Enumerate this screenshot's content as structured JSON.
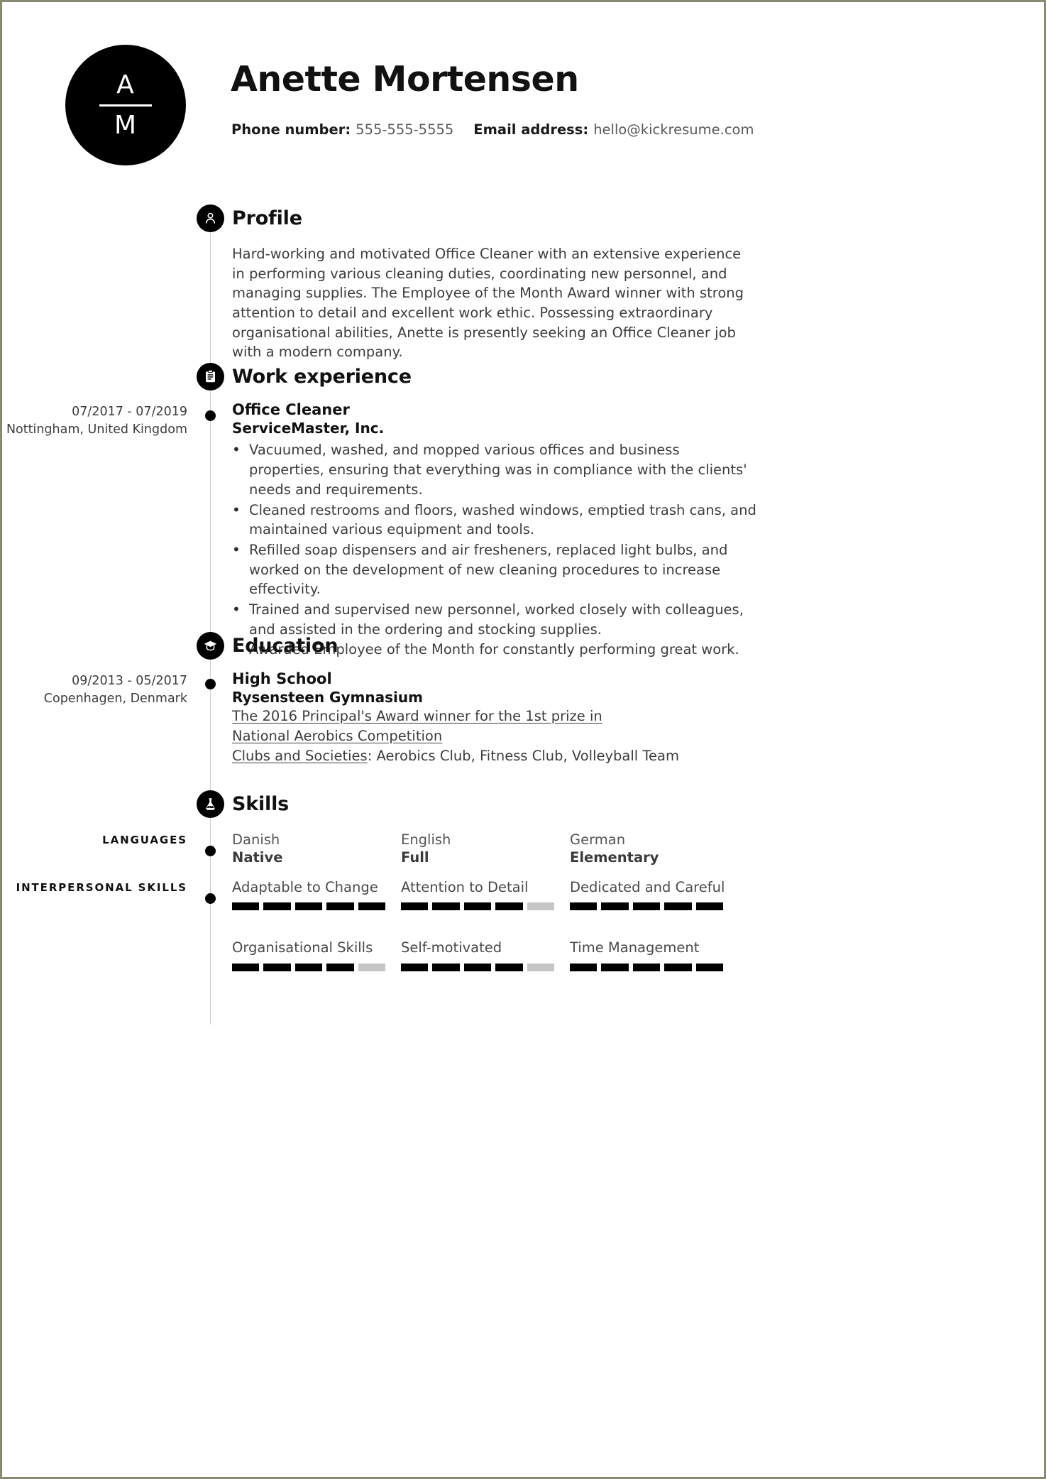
{
  "document": {
    "type": "resume",
    "border_color": "#8a8a70",
    "accent_color": "#000000",
    "muted_color": "#c6c6c6"
  },
  "header": {
    "monogram": {
      "top": "A",
      "bottom": "M"
    },
    "name": "Anette Mortensen",
    "contact": {
      "phone_label": "Phone number:",
      "phone_value": "555-555-5555",
      "email_label": "Email address:",
      "email_value": "hello@kickresume.com"
    }
  },
  "sections": {
    "profile": {
      "title": "Profile",
      "icon": "person-icon",
      "text": "Hard-working and motivated Office Cleaner with an extensive experience in performing various cleaning duties, coordinating new personnel, and managing supplies. The Employee of the Month Award winner with strong attention to detail and excellent work ethic. Possessing extraordinary organisational abilities, Anette is presently seeking an Office Cleaner job with a modern company."
    },
    "work_experience": {
      "title": "Work experience",
      "icon": "clipboard-icon",
      "entries": [
        {
          "dates": "07/2017 - 07/2019",
          "location": "Nottingham, United Kingdom",
          "position": "Office Cleaner",
          "organisation": "ServiceMaster, Inc.",
          "bullets": [
            "Vacuumed, washed, and mopped various offices and business properties, ensuring that everything was in compliance with the clients' needs and requirements.",
            "Cleaned restrooms and floors, washed windows, emptied trash cans, and maintained various equipment and tools.",
            "Refilled soap dispensers and air fresheners, replaced light bulbs, and worked on the development of new cleaning procedures to increase effectivity.",
            "Trained and supervised new personnel, worked closely with colleagues, and assisted in the ordering and stocking supplies.",
            "Awarded Employee of the Month for constantly performing great work."
          ]
        }
      ]
    },
    "education": {
      "title": "Education",
      "icon": "graduation-cap-icon",
      "entries": [
        {
          "dates": "09/2013 - 05/2017",
          "location": "Copenhagen, Denmark",
          "degree": "High School",
          "school": "Rysensteen Gymnasium",
          "award": "The 2016 Principal's Award winner for the 1st prize in National Aerobics Competition",
          "clubs_label": "Clubs and Societies",
          "clubs_value": ": Aerobics Club, Fitness Club, Volleyball Team"
        }
      ]
    },
    "skills": {
      "title": "Skills",
      "icon": "flask-icon",
      "groups": [
        {
          "label": "LANGUAGES",
          "kind": "languages",
          "items": [
            {
              "name": "Danish",
              "level": "Native"
            },
            {
              "name": "English",
              "level": "Full"
            },
            {
              "name": "German",
              "level": "Elementary"
            }
          ]
        },
        {
          "label": "INTERPERSONAL SKILLS",
          "kind": "rated",
          "max": 5,
          "items": [
            {
              "name": "Adaptable to Change",
              "rating": 5
            },
            {
              "name": "Attention to Detail",
              "rating": 4
            },
            {
              "name": "Dedicated and Careful",
              "rating": 5
            },
            {
              "name": "Organisational Skills",
              "rating": 4
            },
            {
              "name": "Self-motivated",
              "rating": 4
            },
            {
              "name": "Time Management",
              "rating": 5
            }
          ]
        }
      ]
    }
  }
}
